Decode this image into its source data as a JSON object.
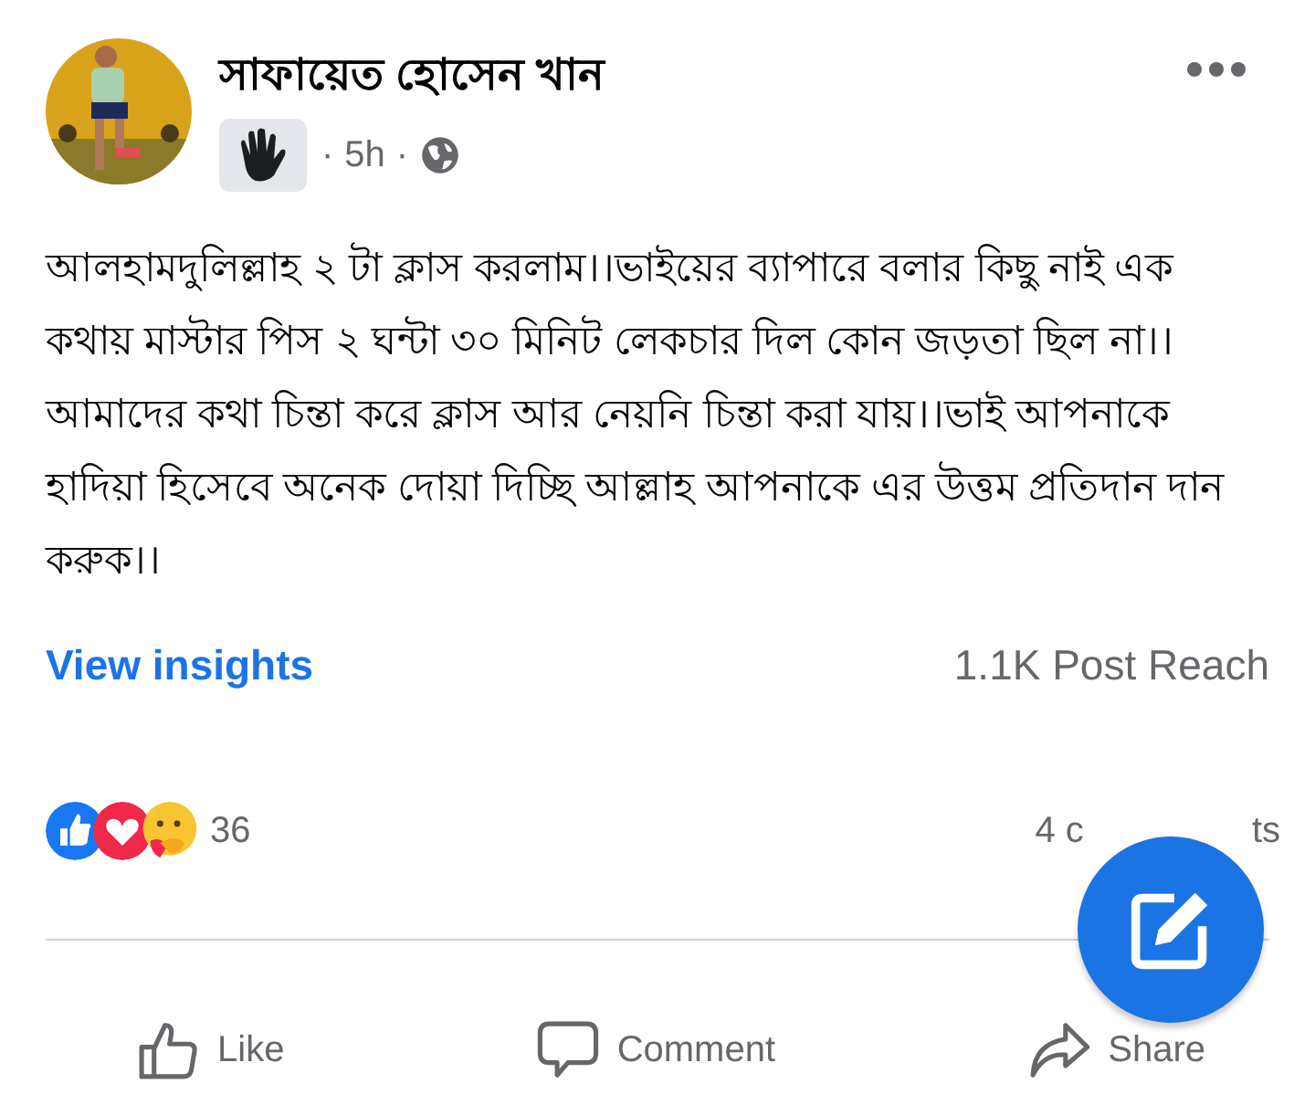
{
  "post": {
    "author": "সাফায়েত হোসেন খান",
    "time": "5h",
    "separator": "·",
    "text": "আলহামদুলিল্লাহ ২ টা ক্লাস করলাম।।ভাইয়ের ব্যাপারে বলার কিছু নাই এক কথায় মাস্টার পিস ২ ঘন্টা ৩০ মিনিট লেকচার দিল কোন জড়তা ছিল না।। আমাদের কথা চিন্তা করে ক্লাস আর নেয়নি চিন্তা করা যায়।।ভাই আপনাকে হাদিয়া হিসেবে অনেক দোয়া দিচ্ছি আল্লাহ আপনাকে এর উত্তম প্রতিদান দান করুক।।"
  },
  "insights": {
    "link": "View insights",
    "reach": "1.1K Post Reach"
  },
  "reactions": {
    "count": "36",
    "comments_fragments": [
      "4 c",
      "ts"
    ]
  },
  "actions": [
    {
      "kind": "like",
      "label": "Like"
    },
    {
      "kind": "comment",
      "label": "Comment"
    },
    {
      "kind": "share",
      "label": "Share"
    }
  ]
}
